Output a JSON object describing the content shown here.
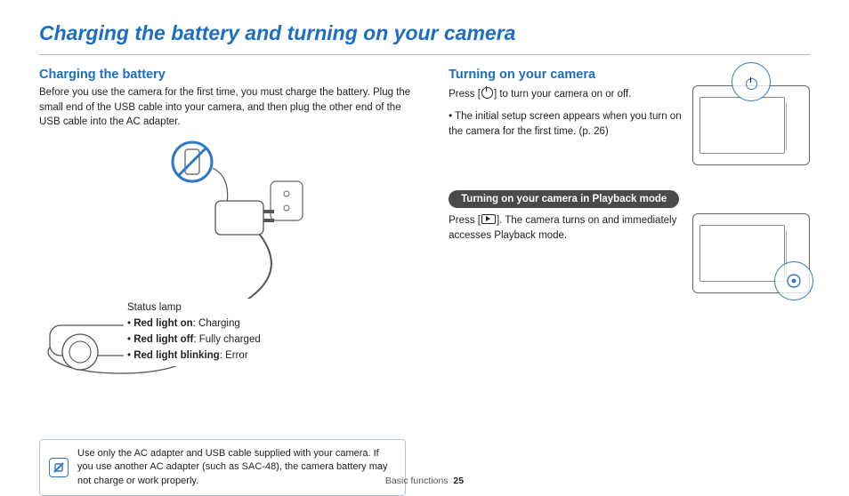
{
  "title": "Charging the battery and turning on your camera",
  "left": {
    "heading": "Charging the battery",
    "intro": "Before you use the camera for the first time, you must charge the battery. Plug the small end of the USB cable into your camera, and then plug the other end of the USB cable into the AC adapter.",
    "status": {
      "title": "Status lamp",
      "items": [
        {
          "label": "Red light on",
          "desc": ": Charging"
        },
        {
          "label": "Red light off",
          "desc": ": Fully charged"
        },
        {
          "label": "Red light blinking",
          "desc": ": Error"
        }
      ]
    },
    "note": "Use only the AC adapter and USB cable supplied with your camera. If you use another AC adapter (such as SAC-48), the camera battery may not charge or work properly."
  },
  "right": {
    "heading": "Turning on your camera",
    "press_prefix": "Press [",
    "press_suffix": "] to turn your camera on or off.",
    "bullet1": "The initial setup screen appears when you turn on the camera for the first time. (p. 26)",
    "pill": "Turning on your camera in Playback mode",
    "playback_prefix": "Press [",
    "playback_suffix": "]. The camera turns on and immediately accesses Playback mode."
  },
  "footer": {
    "section": "Basic functions",
    "page": "25"
  }
}
